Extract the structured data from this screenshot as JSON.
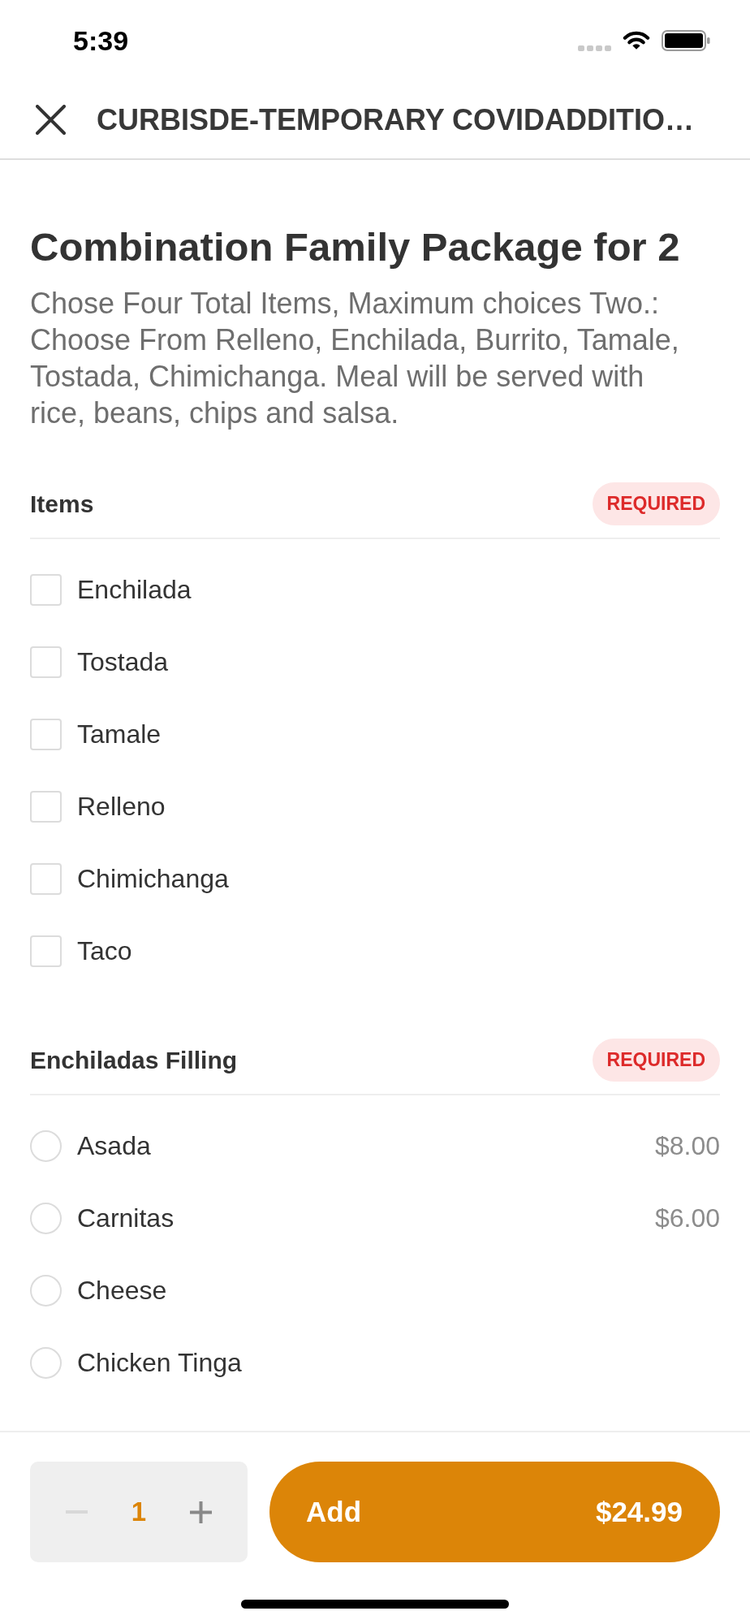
{
  "status_bar": {
    "time": "5:39"
  },
  "header": {
    "title": "CURBISDE-TEMPORARY COVIDADDITIO…"
  },
  "item": {
    "title": "Combination Family Package for 2",
    "description": "Chose Four Total Items, Maximum choices Two.: Choose From Relleno, Enchilada, Burrito, Tamale, Tostada, Chimichanga. Meal will be served with rice, beans, chips and salsa."
  },
  "option_groups": [
    {
      "title": "Items",
      "badge": "REQUIRED",
      "kind": "checkbox",
      "options": [
        {
          "name": "Enchilada",
          "checked": false
        },
        {
          "name": "Tostada",
          "checked": false
        },
        {
          "name": "Tamale",
          "checked": false
        },
        {
          "name": "Relleno",
          "checked": false
        },
        {
          "name": "Chimichanga",
          "checked": false
        },
        {
          "name": "Taco",
          "checked": false
        }
      ]
    },
    {
      "title": "Enchiladas Filling",
      "badge": "REQUIRED",
      "kind": "radio",
      "options": [
        {
          "name": "Asada",
          "price": "$8.00",
          "selected": false
        },
        {
          "name": "Carnitas",
          "price": "$6.00",
          "selected": false
        },
        {
          "name": "Cheese",
          "selected": false
        },
        {
          "name": "Chicken Tinga",
          "selected": false
        }
      ]
    }
  ],
  "footer": {
    "quantity": "1",
    "decrease_disabled": true,
    "add_button": {
      "label": "Add",
      "price": "$24.99"
    }
  }
}
